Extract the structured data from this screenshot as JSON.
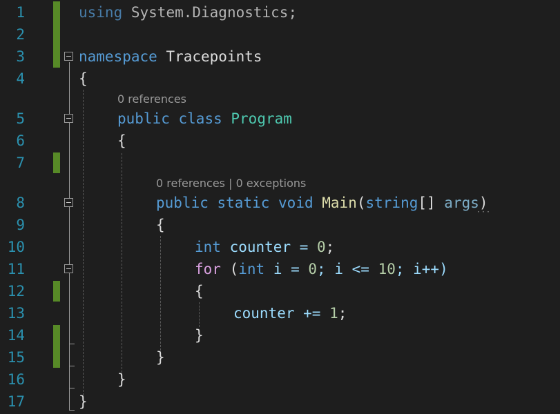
{
  "line_numbers": [
    "1",
    "2",
    "3",
    "4",
    "5",
    "6",
    "7",
    "8",
    "9",
    "10",
    "11",
    "12",
    "13",
    "14",
    "15",
    "16",
    "17"
  ],
  "codelens": {
    "class": "0 references",
    "main_refs": "0 references",
    "main_separator": "|",
    "main_exceptions": "0 exceptions"
  },
  "code": {
    "l1_using": "using",
    "l1_ns": "System.Diagnostics;",
    "l3_namespace": "namespace",
    "l3_name": "Tracepoints",
    "l4_brace": "{",
    "l5_public": "public",
    "l5_class": "class",
    "l5_name": "Program",
    "l6_brace": "{",
    "l8_public": "public",
    "l8_static": "static",
    "l8_void": "void",
    "l8_method": "Main",
    "l8_open": "(",
    "l8_string": "string",
    "l8_brackets": "[] ",
    "l8_args": "args",
    "l8_close": ")",
    "l9_brace": "{",
    "l10_int": "int",
    "l10_rest": " counter = ",
    "l10_num": "0",
    "l10_semi": ";",
    "l11_for": "for",
    "l11_open": " (",
    "l11_int": "int",
    "l11_a": " i = ",
    "l11_n0": "0",
    "l11_b": "; i <= ",
    "l11_n10": "10",
    "l11_c": "; i++)",
    "l12_brace": "{",
    "l13_rest": "counter += ",
    "l13_num": "1",
    "l13_semi": ";",
    "l14_brace": "}",
    "l15_brace": "}",
    "l16_brace": "}",
    "l17_brace": "}"
  },
  "colors": {
    "background": "#1e1e1e",
    "line_number": "#2b91af",
    "keyword": "#569cd6",
    "control": "#d8a0df",
    "type": "#4ec9b0",
    "method": "#dcdcaa",
    "number": "#b5cea8",
    "parameter": "#9cdcfe",
    "change_marker": "#578a27"
  }
}
